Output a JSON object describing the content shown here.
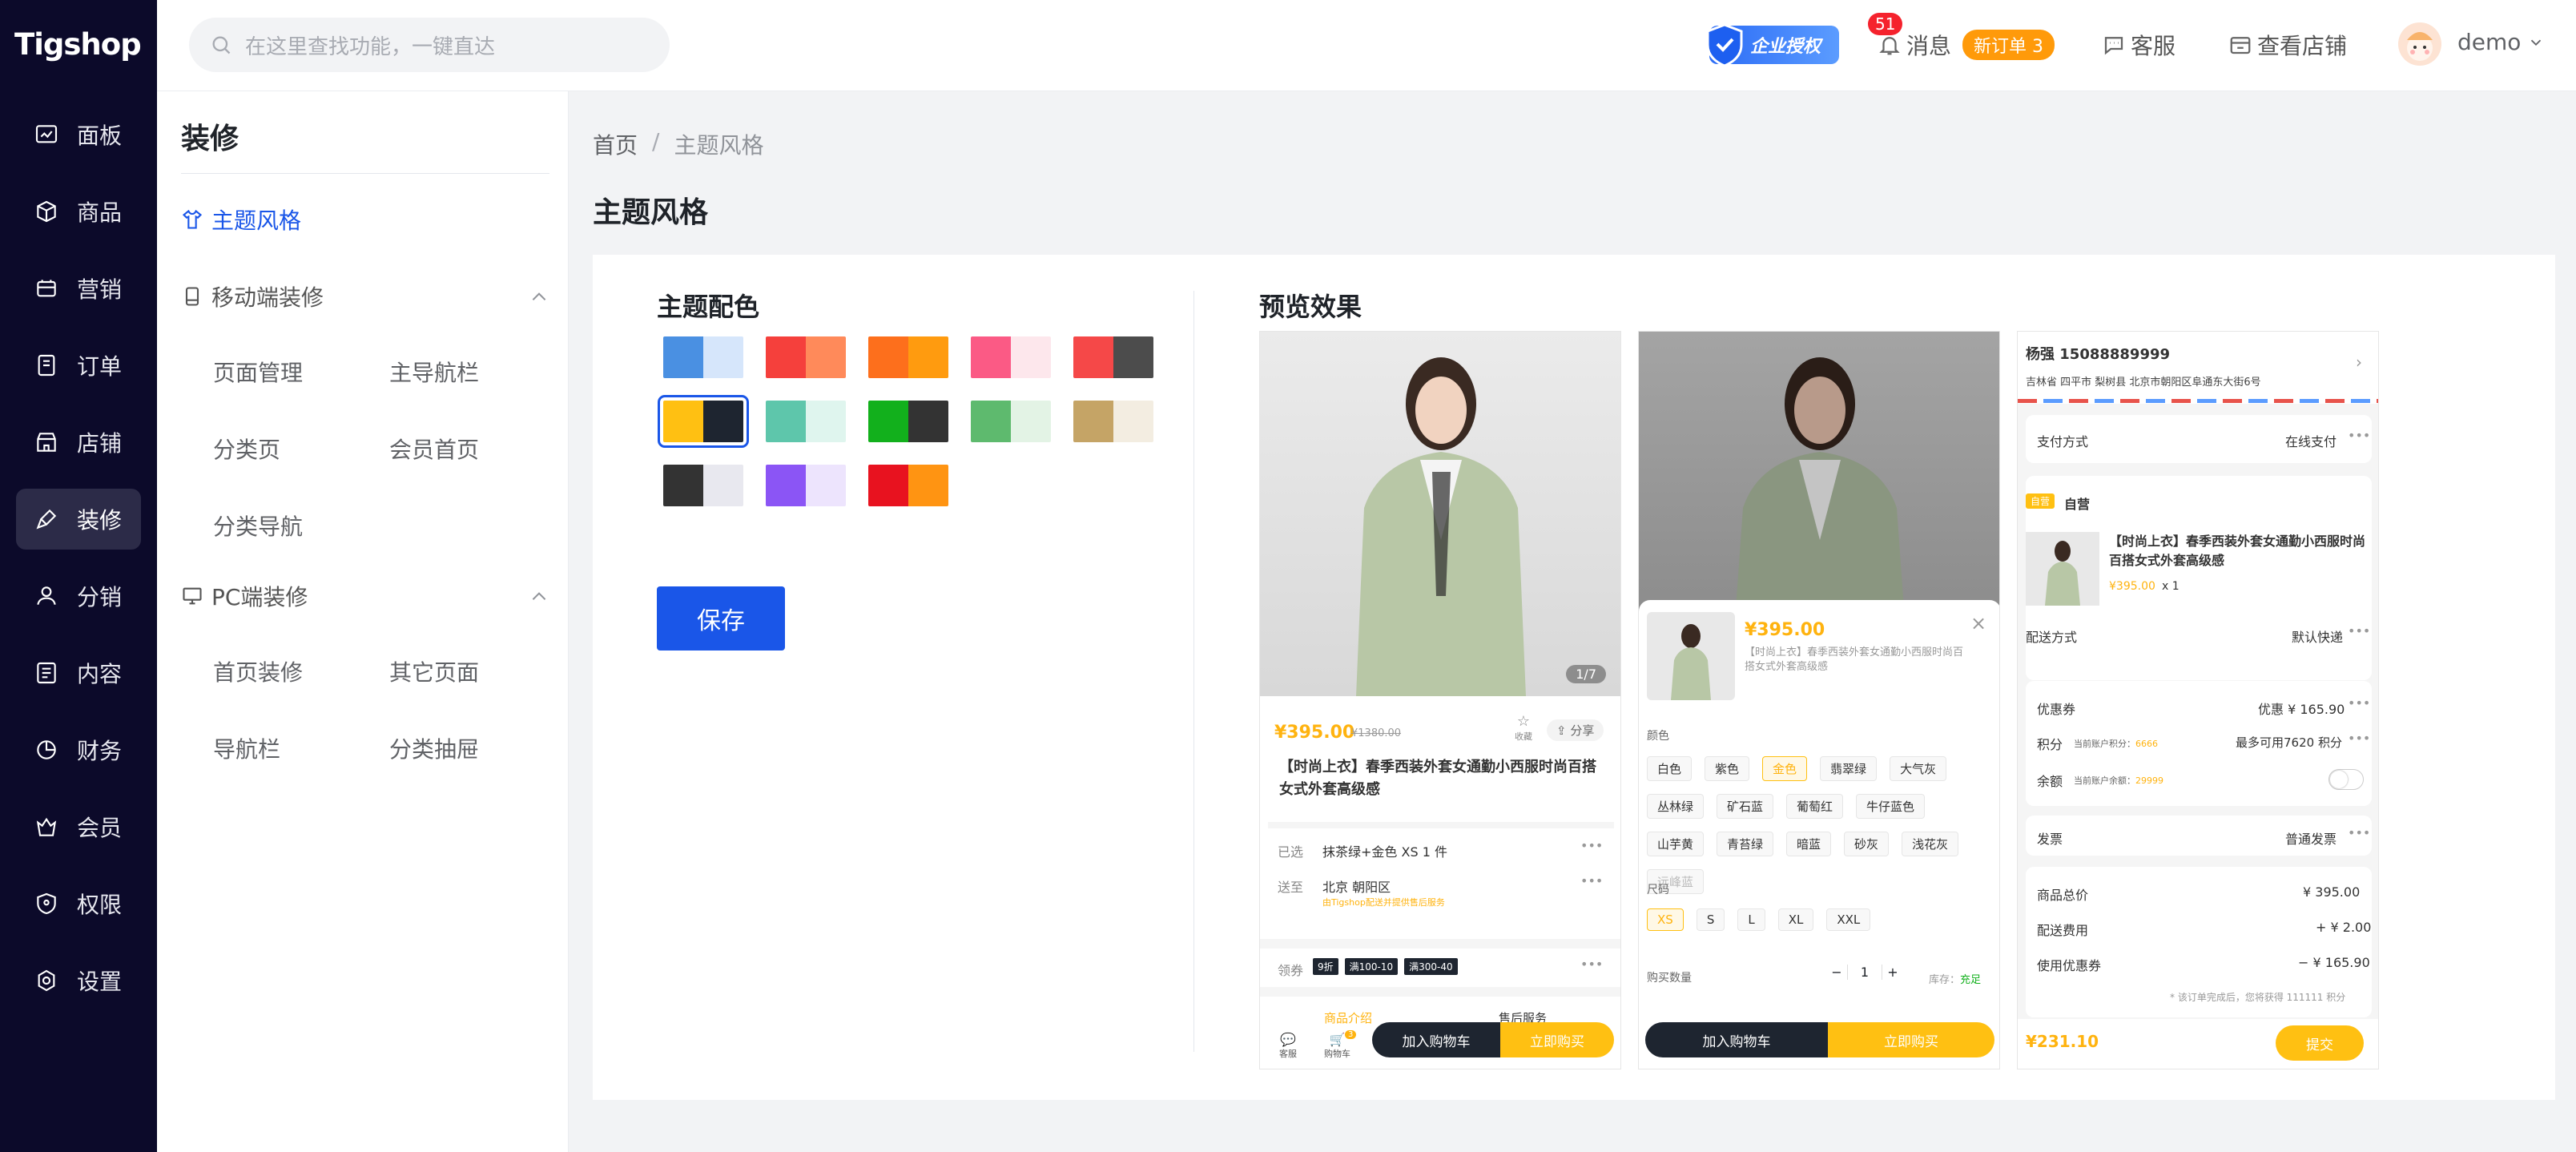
{
  "app": {
    "logo": "Tigshop"
  },
  "sidebar": {
    "items": [
      {
        "label": "面板",
        "icon": "dashboard-icon"
      },
      {
        "label": "商品",
        "icon": "box-icon"
      },
      {
        "label": "营销",
        "icon": "marketing-icon"
      },
      {
        "label": "订单",
        "icon": "order-icon"
      },
      {
        "label": "店铺",
        "icon": "store-icon"
      },
      {
        "label": "装修",
        "icon": "brush-icon",
        "active": true
      },
      {
        "label": "分销",
        "icon": "distribution-icon"
      },
      {
        "label": "内容",
        "icon": "content-icon"
      },
      {
        "label": "财务",
        "icon": "finance-icon"
      },
      {
        "label": "会员",
        "icon": "member-icon"
      },
      {
        "label": "权限",
        "icon": "permission-icon"
      },
      {
        "label": "设置",
        "icon": "settings-icon"
      }
    ]
  },
  "topbar": {
    "search_placeholder": "在这里查找功能，一键直达",
    "auth_badge": "企业授权",
    "message_count": "51",
    "message_label": "消息",
    "new_order": "新订单 3",
    "service": "客服",
    "view_store": "查看店铺",
    "user": "demo"
  },
  "submenu": {
    "title": "装修",
    "active_item": "主题风格",
    "mobile": {
      "title": "移动端装修",
      "items": [
        "页面管理",
        "主导航栏",
        "分类页",
        "会员首页",
        "分类导航"
      ]
    },
    "pc": {
      "title": "PC端装修",
      "items": [
        "首页装修",
        "其它页面",
        "导航栏",
        "分类抽屉"
      ]
    }
  },
  "breadcrumb": {
    "home": "首页",
    "sep": "/",
    "current": "主题风格"
  },
  "page_title": "主题风格",
  "theme": {
    "title": "主题配色",
    "selected_index": 5,
    "swatches": [
      [
        "#4a90e2",
        "#d6e6fb"
      ],
      [
        "#f5403c",
        "#ff8a5a"
      ],
      [
        "#fd6f1c",
        "#ff9b0f"
      ],
      [
        "#fb5a85",
        "#fde7ec"
      ],
      [
        "#f54848",
        "#4c4c4c"
      ],
      [
        "#ffc012",
        "#1e2530"
      ],
      [
        "#5ec6ab",
        "#dff5ee"
      ],
      [
        "#12b01c",
        "#333333"
      ],
      [
        "#5eba6e",
        "#e3f3e5"
      ],
      [
        "#c5a466",
        "#f3ede1"
      ],
      [
        "#333333",
        "#e8e8ef"
      ],
      [
        "#8b55f5",
        "#ede4fd"
      ],
      [
        "#e8121f",
        "#ff9412"
      ]
    ],
    "save_label": "保存"
  },
  "preview": {
    "title": "预览效果",
    "p1": {
      "page": "1/7",
      "price": "¥395.00",
      "old_price": "¥1380.00",
      "fav": "收藏",
      "share": "分享",
      "product": "【时尚上衣】春季西装外套女通勤小西服时尚百搭女式外套高级感",
      "selected_label": "已选",
      "selected_value": "抹茶绿+金色 XS 1 件",
      "ship_label": "送至",
      "ship_value": "北京 朝阳区",
      "ship_note": "由Tigshop配送并提供售后服务",
      "coupon_label": "领券",
      "coupons": [
        "9折",
        "满100-10",
        "满300-40"
      ],
      "tab_intro": "商品介绍",
      "tab_service": "售后服务",
      "kefu": "客服",
      "cart": "购物车",
      "cart_count": "3",
      "add_cart": "加入购物车",
      "buy_now": "立即购买"
    },
    "p2": {
      "price": "¥395.00",
      "product": "【时尚上衣】春季西装外套女通勤小西服时尚百搭女式外套高级感",
      "color_label": "颜色",
      "colors": [
        "白色",
        "紫色",
        "金色",
        "翡翠绿",
        "大气灰",
        "丛林绿",
        "矿石蓝",
        "葡萄红",
        "牛仔蓝色",
        "山芋黄",
        "青苔绿",
        "暗蓝",
        "砂灰",
        "浅花灰",
        "远峰蓝"
      ],
      "selected_color": "金色",
      "size_label": "尺码",
      "sizes": [
        "XS",
        "S",
        "L",
        "XL",
        "XXL"
      ],
      "qty_label": "购买数量",
      "qty": "1",
      "stock_label": "库存：",
      "stock_value": "充足",
      "add_cart": "加入购物车",
      "buy_now": "立即购买"
    },
    "p3": {
      "name": "杨强 15088889999",
      "address": "吉林省 四平市 梨树县 北京市朝阳区阜通东大街6号",
      "pay_label": "支付方式",
      "pay_value": "在线支付",
      "shop_tag": "自营",
      "shop_name": "自营",
      "product": "【时尚上衣】春季西装外套女通勤小西服时尚百搭女式外套高级感",
      "price": "¥395.00",
      "qty": "x 1",
      "delivery_label": "配送方式",
      "delivery_value": "默认快递",
      "coupon_label": "优惠券",
      "coupon_value": "优惠 ¥ 165.90",
      "points_label": "积分",
      "points_note": "当前账户积分：",
      "points_num": "6666",
      "points_value": "最多可用7620 积分",
      "balance_label": "余额",
      "balance_note": "当前账户余额：",
      "balance_num": "29999",
      "invoice_label": "发票",
      "invoice_value": "普通发票",
      "total_label": "商品总价",
      "total_value": "¥ 395.00",
      "ship_fee_label": "配送费用",
      "ship_fee_value": "+ ¥ 2.00",
      "coupon_use_label": "使用优惠券",
      "coupon_use_value": "− ¥ 165.90",
      "reward_note": "* 该订单完成后，您将获得 111111 积分",
      "pay_total": "¥231.10",
      "submit": "提交"
    }
  }
}
